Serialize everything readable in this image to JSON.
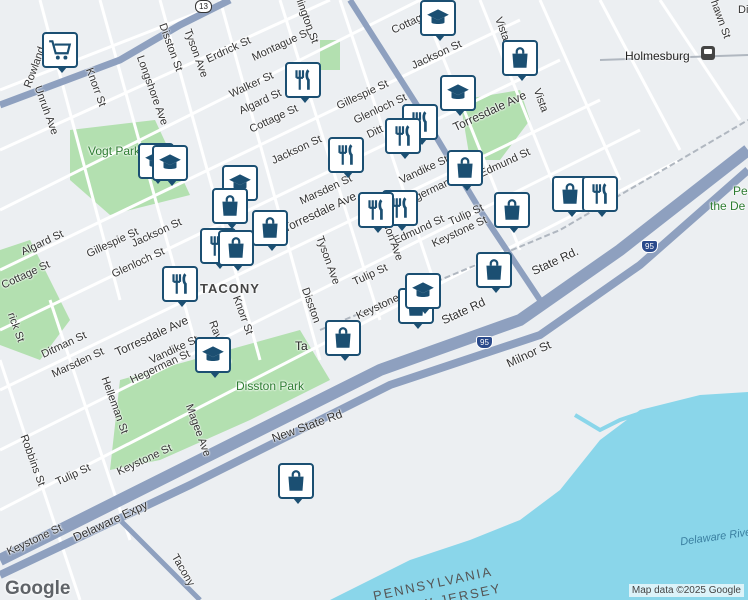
{
  "map": {
    "attribution": "Map data ©2025 Google",
    "logo": "Google",
    "colors": {
      "land": "#eceff2",
      "water": "#8ad6ea",
      "park": "#b3e0b0",
      "road": "#ffffff",
      "highway": "#8ea0bf",
      "pin_border": "#1b4f72"
    },
    "labels": {
      "rowland": "Rowland",
      "unruh": "Unruh Ave",
      "knorr_top": "Knorr St",
      "longshore": "Longshore Ave",
      "disston_top": "Disston St",
      "tyson_top": "Tyson Ave",
      "erdrick": "Erdrick St",
      "montague": "Montague St",
      "wellington": "Wellington St",
      "walker": "Walker St",
      "algard_top": "Algard St",
      "cottage_top": "Cottage St",
      "gillespie_top": "Gillespie St",
      "glenloch_top": "Glenloch St",
      "jackson_mid": "Jackson St",
      "jackson_top": "Jackson St",
      "cottage_right": "Cottage St",
      "vista_st": "Vista St",
      "vista_top": "Vista",
      "torresdale_right": "Torresdale Ave",
      "holmesburg": "Holmesburg",
      "dittman_top": "Ditt",
      "vogt_park": "Vogt Park",
      "algard_left": "Algard St",
      "gillespie_left": "Gillespie St",
      "jackson_left": "Jackson St",
      "glenloch_left": "Glenloch St",
      "marsden_mid": "Marsden St",
      "torresdale_mid": "Torresdale Ave",
      "vandike_mid": "Vandike St",
      "hegerman_mid": "Hegerman St",
      "edmund_mid": "Edmund St",
      "edmund_right": "Edmund St",
      "tulip_right": "Tulip St",
      "keystone_right": "Keystone St",
      "state_rd_right": "State Rd.",
      "state_rd_mid": "State Rd",
      "tacony": "TACONY",
      "cottage_left": "Cottage St",
      "rick_st": "rick St",
      "knorr_mid": "Knorr St",
      "tyson_mid": "Tyson Ave",
      "disston_mid": "Disston",
      "tulip_mid": "Tulip St",
      "keystone_mid": "Keystone",
      "milnor": "Milnor St",
      "ditman_left": "Ditman St",
      "marsden_left": "Marsden St",
      "torresdale_left": "Torresdale Ave",
      "vandike_left": "Vandike St",
      "hegerman_left": "Hegerman St",
      "helleman": "Helleman St",
      "robbins": "Robbins St",
      "magee": "Magee Ave",
      "disston_park": "Disston Park",
      "ta": "Ta",
      "new_state_rd": "New State Rd",
      "keystone_low": "Keystone St",
      "tulip_low": "Tulip St",
      "delaware_expy": "Delaware Expy",
      "keystone_bottom": "Keystone St",
      "tacony_bottom": "Tacony",
      "pennsylvania": "PENNSYLVANIA",
      "new_jersey": "NEW JERSEY",
      "delaware_river": "Delaware River",
      "pennyp": "Pennyp",
      "the_de": "the De",
      "ditman_topright": "Ditm",
      "shawn": "hawn St",
      "rav": "Rav",
      "r_ave": "Ave",
      "ion_ave": "ion Ave",
      "ellington": "ellington St"
    },
    "shields": {
      "us13": "13",
      "i95_right": "95",
      "i95_mid": "95"
    },
    "pins": [
      {
        "type": "school-icon"
      },
      {
        "type": "grocery-cart-icon"
      },
      {
        "type": "shopping-bag-icon"
      },
      {
        "type": "restaurant-icon"
      },
      {
        "type": "school-icon"
      },
      {
        "type": "restaurant-icon"
      },
      {
        "type": "restaurant-icon"
      },
      {
        "type": "school-icon"
      },
      {
        "type": "school-icon"
      },
      {
        "type": "school-icon"
      },
      {
        "type": "shopping-bag-icon"
      },
      {
        "type": "restaurant-icon"
      },
      {
        "type": "restaurant-icon"
      },
      {
        "type": "shopping-bag-icon"
      },
      {
        "type": "shopping-bag-icon"
      },
      {
        "type": "shopping-bag-icon"
      },
      {
        "type": "restaurant-icon"
      },
      {
        "type": "shopping-bag-icon"
      },
      {
        "type": "restaurant-icon"
      },
      {
        "type": "restaurant-icon"
      },
      {
        "type": "shopping-bag-icon"
      },
      {
        "type": "shopping-bag-icon"
      },
      {
        "type": "shopping-bag-icon"
      },
      {
        "type": "restaurant-icon"
      },
      {
        "type": "school-icon"
      },
      {
        "type": "shopping-bag-icon"
      },
      {
        "type": "shopping-bag-icon"
      },
      {
        "type": "school-icon"
      }
    ]
  }
}
